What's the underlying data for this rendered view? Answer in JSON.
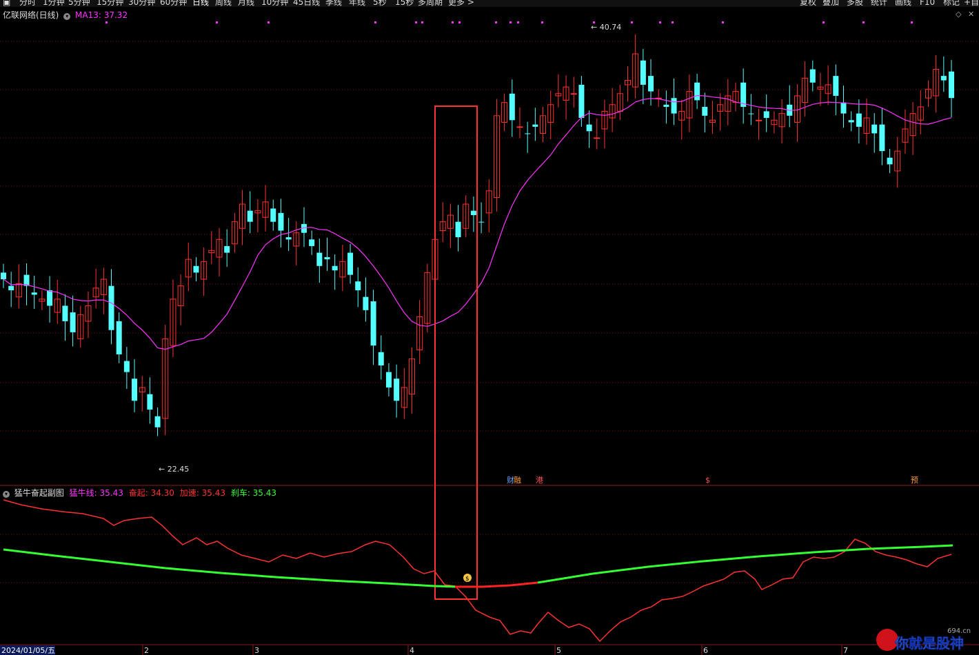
{
  "toolbar": {
    "left_icon": "window-icon",
    "items": [
      "分时",
      "1分钟",
      "5分钟",
      "15分钟",
      "30分钟",
      "60分钟",
      "日线",
      "周线",
      "月线",
      "10分钟",
      "45日线",
      "季线",
      "年线",
      "5秒",
      "15秒",
      "多周期",
      "更多 >"
    ],
    "active": "日线",
    "right_items": [
      "复权",
      "叠加",
      "多股",
      "统计",
      "画线",
      "F10",
      "标记",
      "+自"
    ]
  },
  "main_chart": {
    "stock_name": "亿联网络(日线)",
    "ma_label": "MA13: 37.32",
    "high_label": "40.74",
    "low_label": "22.45",
    "event_markers": [
      "财",
      "融",
      "港",
      "$",
      "预"
    ],
    "colors": {
      "up": "#ff3232",
      "down": "#54ffff",
      "ma": "#ff33ff",
      "box": "#ff3232"
    }
  },
  "sub_chart": {
    "title": "猛牛奋起副图",
    "legend": [
      {
        "label": "猛牛线: 35.43",
        "color": "#ff33ff"
      },
      {
        "label": "奋起: 34.30",
        "color": "#ff3232"
      },
      {
        "label": "加速: 35.43",
        "color": "#ff3232"
      },
      {
        "label": "刹车: 35.43",
        "color": "#33ff33"
      }
    ]
  },
  "date_axis": {
    "first_date": "2024/01/05/五",
    "month_ticks": [
      "2",
      "3",
      "4",
      "5",
      "6",
      "7"
    ]
  },
  "watermark": {
    "text": "你就是股神",
    "sub": "694.cn"
  },
  "chart_data": {
    "type": "candlestick",
    "title": "亿联网络(日线)",
    "period": "日线",
    "series": [
      {
        "name": "K线",
        "type": "candlestick",
        "up_count_approx": 64,
        "down_count_approx": 60
      },
      {
        "name": "MA13",
        "last_value": 37.32
      }
    ],
    "annotations": {
      "period_high": 40.74,
      "period_low": 22.45
    },
    "indicator": {
      "name": "猛牛奋起副图",
      "values": {
        "猛牛线": 35.43,
        "奋起": 34.3,
        "加速": 35.43,
        "刹车": 35.43
      }
    },
    "x_ticks": [
      "2024/01/05/五",
      "2",
      "3",
      "4",
      "5",
      "6",
      "7"
    ]
  }
}
